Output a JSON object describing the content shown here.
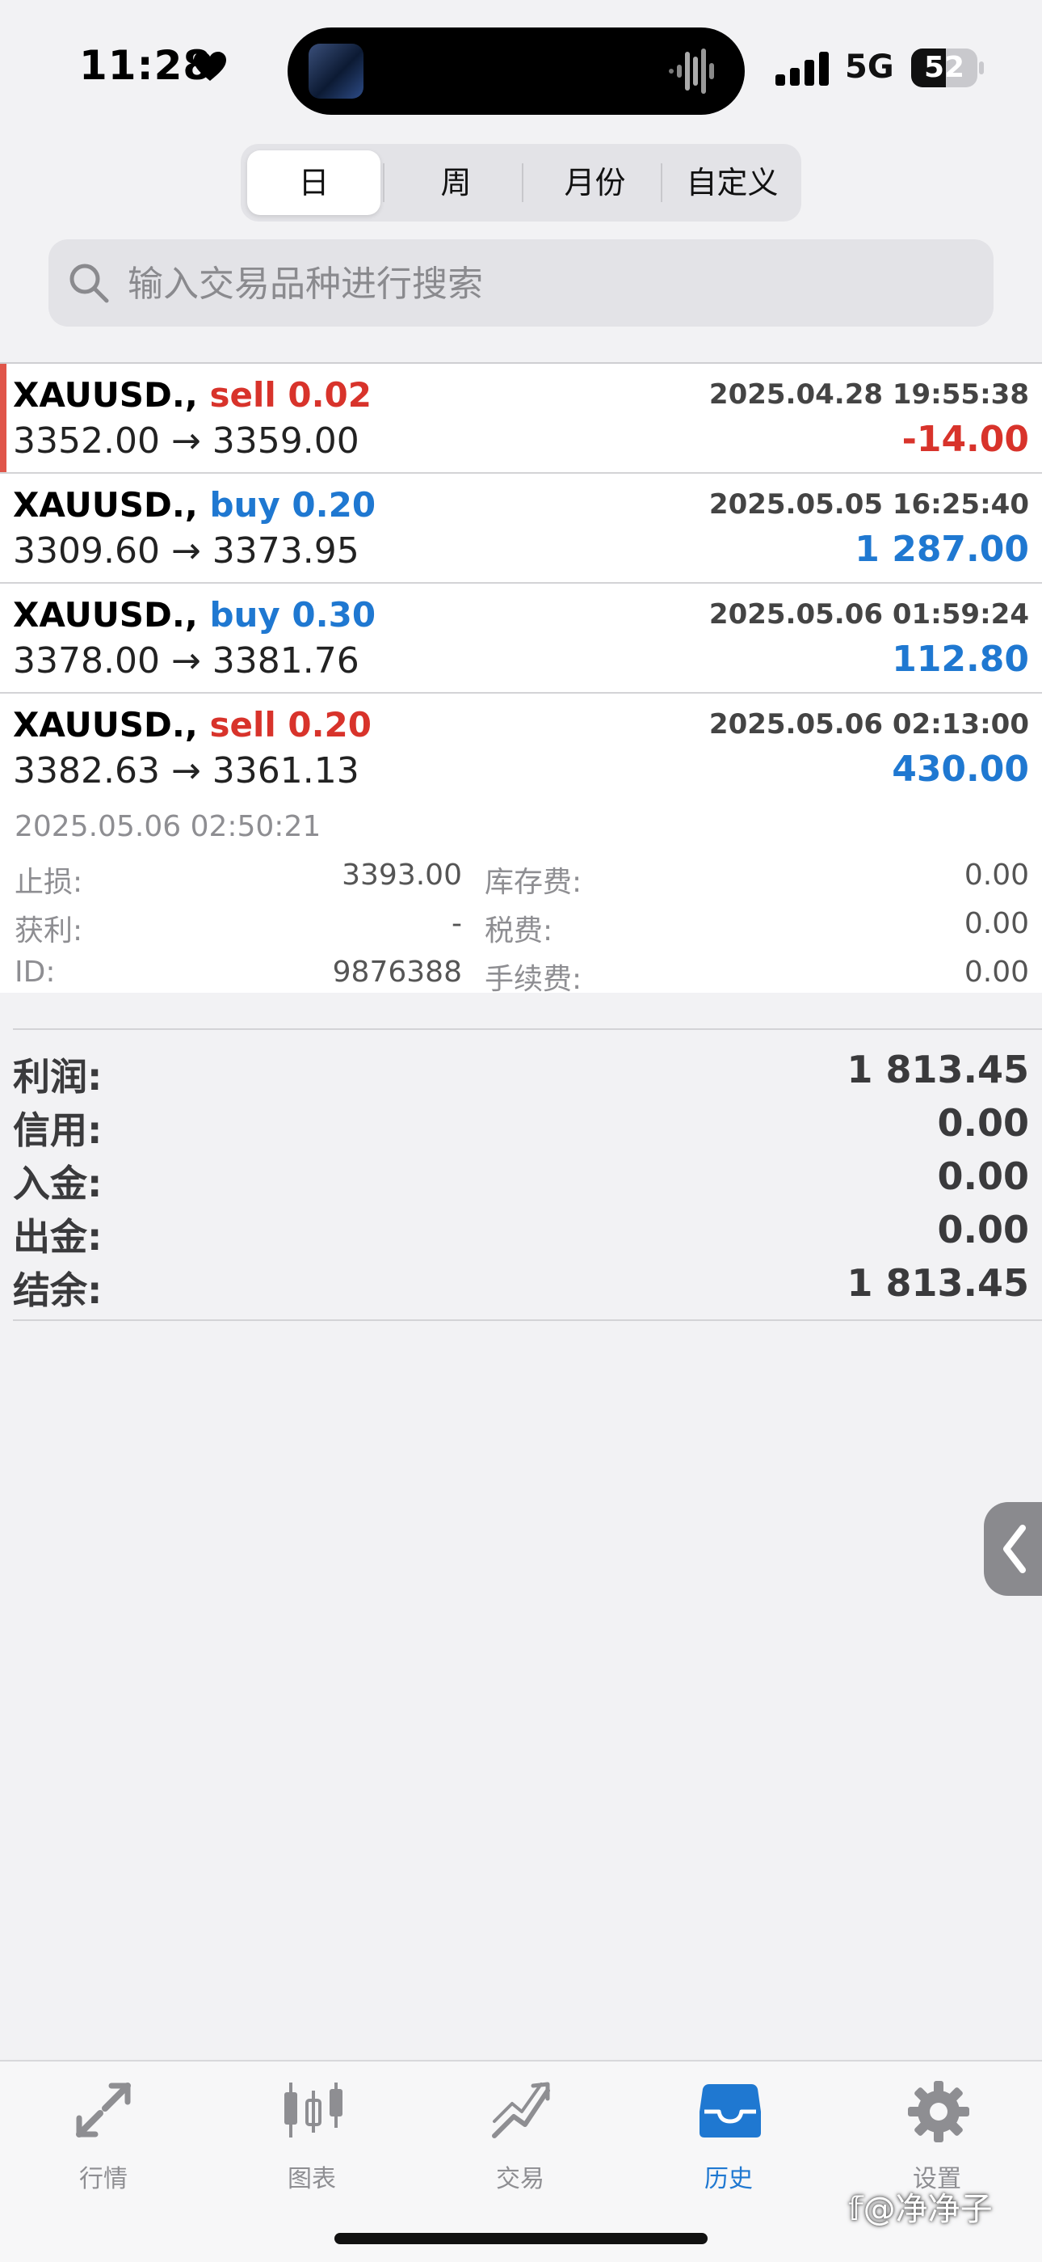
{
  "status_bar": {
    "time": "11:28",
    "network": "5G",
    "battery": "52",
    "battery_level": 0.52
  },
  "period_tabs": [
    {
      "label": "日",
      "active": true
    },
    {
      "label": "周",
      "active": false
    },
    {
      "label": "月份",
      "active": false
    },
    {
      "label": "自定义",
      "active": false
    }
  ],
  "search": {
    "placeholder": "输入交易品种进行搜索",
    "value": ""
  },
  "trades": [
    {
      "symbol": "XAUUSD.,",
      "side": "sell 0.02",
      "time": "2025.04.28 19:55:38",
      "prices": "3352.00 → 3359.00",
      "profit": "-14.00",
      "selected": true
    },
    {
      "symbol": "XAUUSD.,",
      "side": "buy 0.20",
      "time": "2025.05.05 16:25:40",
      "prices": "3309.60 → 3373.95",
      "profit": "1 287.00",
      "selected": false
    },
    {
      "symbol": "XAUUSD.,",
      "side": "buy 0.30",
      "time": "2025.05.06 01:59:24",
      "prices": "3378.00 → 3381.76",
      "profit": "112.80",
      "selected": false
    },
    {
      "symbol": "XAUUSD.,",
      "side": "sell 0.20",
      "time": "2025.05.06 02:13:00",
      "prices": "3382.63 → 3361.13",
      "profit": "430.00",
      "selected": false
    }
  ],
  "trade_detail": {
    "close_time": "2025.05.06 02:50:21",
    "stop_loss_label": "止损:",
    "stop_loss": "3393.00",
    "take_profit_label": "获利:",
    "take_profit": "-",
    "id_label": "ID:",
    "id": "9876388",
    "swap_label": "库存费:",
    "swap": "0.00",
    "tax_label": "税费:",
    "tax": "0.00",
    "commission_label": "手续费:",
    "commission": "0.00"
  },
  "summary": [
    {
      "label": "利润:",
      "value": "1 813.45"
    },
    {
      "label": "信用:",
      "value": "0.00"
    },
    {
      "label": "入金:",
      "value": "0.00"
    },
    {
      "label": "出金:",
      "value": "0.00"
    },
    {
      "label": "结余:",
      "value": "1 813.45"
    }
  ],
  "tabbar": [
    {
      "label": "行情",
      "icon": "quotes-arrows-icon",
      "active": false
    },
    {
      "label": "图表",
      "icon": "candlestick-chart-icon",
      "active": false
    },
    {
      "label": "交易",
      "icon": "trade-trend-icon",
      "active": false
    },
    {
      "label": "历史",
      "icon": "history-inbox-icon",
      "active": true
    },
    {
      "label": "设置",
      "icon": "gear-icon",
      "active": false
    }
  ],
  "watermark": "𝕗@净净子",
  "colors": {
    "sell": "#d8332b",
    "buy": "#1f78d1",
    "selected_marker": "#e0564a",
    "active_tab": "#1f78d1"
  }
}
